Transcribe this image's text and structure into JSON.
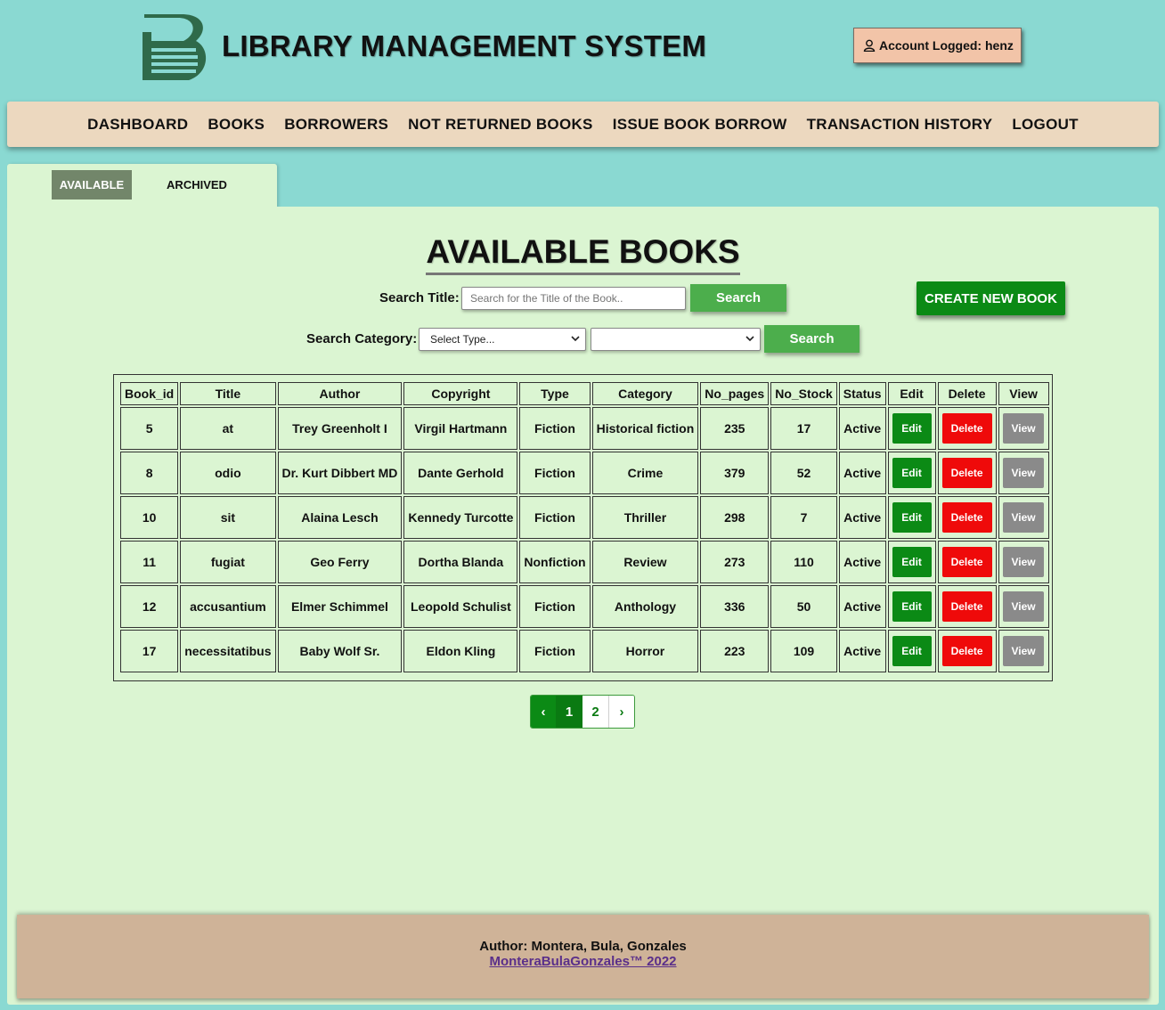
{
  "header": {
    "title": "LIBRARY MANAGEMENT SYSTEM",
    "account_text": "Account Logged: henz"
  },
  "nav": [
    "DASHBOARD",
    "BOOKS",
    "BORROWERS",
    "NOT RETURNED BOOKS",
    "ISSUE BOOK BORROW",
    "TRANSACTION HISTORY",
    "LOGOUT"
  ],
  "tabs": {
    "available": "AVAILABLE",
    "archived": "ARCHIVED"
  },
  "main": {
    "title": "AVAILABLE BOOKS",
    "search_title_label": "Search Title:",
    "search_placeholder": "Search for the Title of the Book..",
    "search_button": "Search",
    "create_button": "CREATE NEW BOOK",
    "search_category_label": "Search Category:",
    "type_select_value": "Select Type...",
    "category_select_value": "",
    "category_search_button": "Search"
  },
  "table": {
    "headers": [
      "Book_id",
      "Title",
      "Author",
      "Copyright",
      "Type",
      "Category",
      "No_pages",
      "No_Stock",
      "Status",
      "Edit",
      "Delete",
      "View"
    ],
    "rows": [
      [
        "5",
        "at",
        "Trey Greenholt I",
        "Virgil Hartmann",
        "Fiction",
        "Historical fiction",
        "235",
        "17",
        "Active"
      ],
      [
        "8",
        "odio",
        "Dr. Kurt Dibbert MD",
        "Dante Gerhold",
        "Fiction",
        "Crime",
        "379",
        "52",
        "Active"
      ],
      [
        "10",
        "sit",
        "Alaina Lesch",
        "Kennedy Turcotte",
        "Fiction",
        "Thriller",
        "298",
        "7",
        "Active"
      ],
      [
        "11",
        "fugiat",
        "Geo Ferry",
        "Dortha Blanda",
        "Nonfiction",
        "Review",
        "273",
        "110",
        "Active"
      ],
      [
        "12",
        "accusantium",
        "Elmer Schimmel",
        "Leopold Schulist",
        "Fiction",
        "Anthology",
        "336",
        "50",
        "Active"
      ],
      [
        "17",
        "necessitatibus",
        "Baby Wolf Sr.",
        "Eldon Kling",
        "Fiction",
        "Horror",
        "223",
        "109",
        "Active"
      ]
    ],
    "edit_label": "Edit",
    "delete_label": "Delete",
    "view_label": "View"
  },
  "pagination": {
    "prev": "‹",
    "pages": [
      "1",
      "2"
    ],
    "current": "1",
    "next": "›"
  },
  "footer": {
    "author": "Author: Montera, Bula, Gonzales",
    "copyright": "MonteraBulaGonzales™ 2022"
  },
  "colors": {
    "background": "#8ad9d2",
    "nav": "#ecd8bf",
    "panel": "#dbf5d2",
    "edit": "#0b8a15",
    "delete": "#ef0a0a",
    "view": "#8a8a8a",
    "footer": "#cfb398"
  }
}
